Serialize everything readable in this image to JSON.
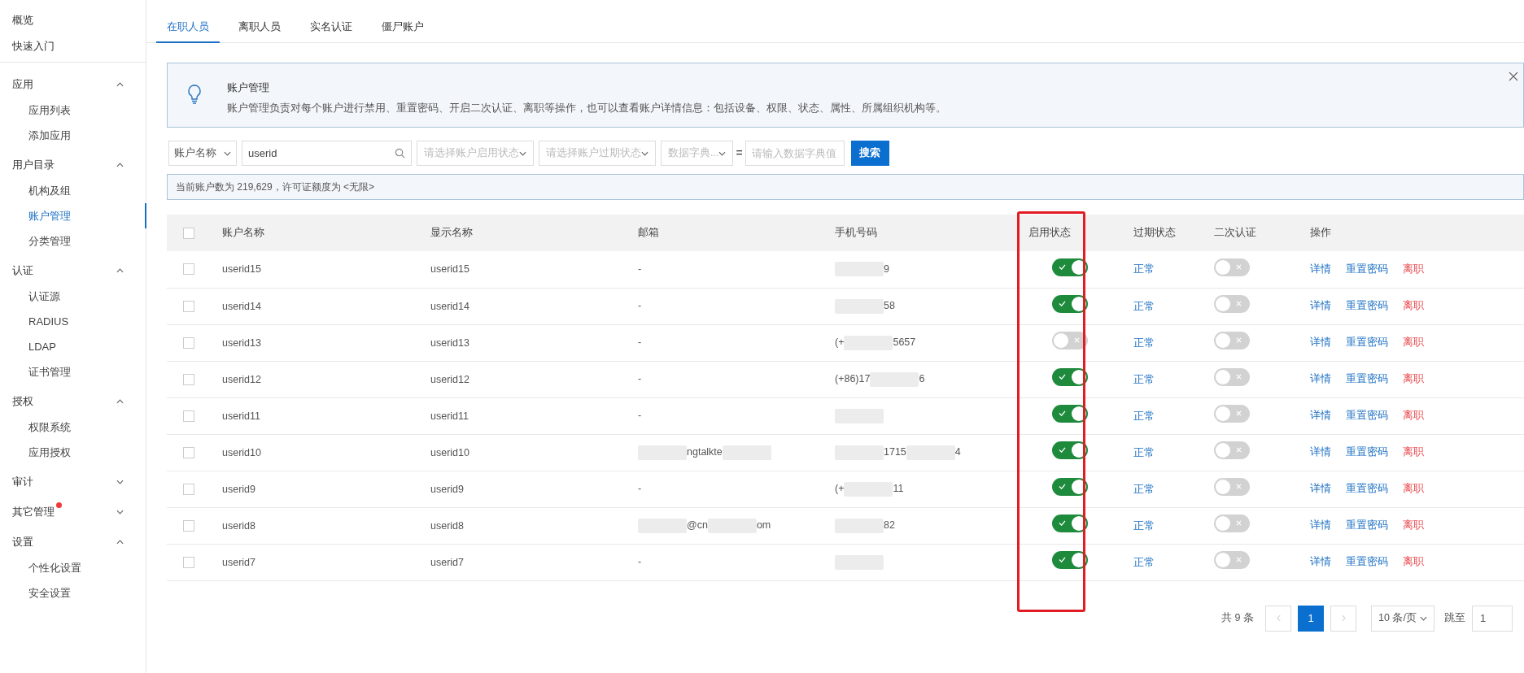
{
  "sidebar": {
    "top_items": [
      {
        "label": "概览",
        "selected": false
      },
      {
        "label": "快速入门",
        "selected": false
      }
    ],
    "groups": [
      {
        "label": "应用",
        "expanded": true,
        "notification": false,
        "items": [
          {
            "label": "应用列表",
            "selected": false
          },
          {
            "label": "添加应用",
            "selected": false
          }
        ]
      },
      {
        "label": "用户目录",
        "expanded": true,
        "notification": false,
        "items": [
          {
            "label": "机构及组",
            "selected": false
          },
          {
            "label": "账户管理",
            "selected": true
          },
          {
            "label": "分类管理",
            "selected": false
          }
        ]
      },
      {
        "label": "认证",
        "expanded": true,
        "notification": false,
        "items": [
          {
            "label": "认证源",
            "selected": false
          },
          {
            "label": "RADIUS",
            "selected": false
          },
          {
            "label": "LDAP",
            "selected": false
          },
          {
            "label": "证书管理",
            "selected": false
          }
        ]
      },
      {
        "label": "授权",
        "expanded": true,
        "notification": false,
        "items": [
          {
            "label": "权限系统",
            "selected": false
          },
          {
            "label": "应用授权",
            "selected": false
          }
        ]
      },
      {
        "label": "审计",
        "expanded": false,
        "notification": false
      },
      {
        "label": "其它管理",
        "expanded": false,
        "notification": true
      },
      {
        "label": "设置",
        "expanded": true,
        "notification": false,
        "items": [
          {
            "label": "个性化设置",
            "selected": false
          },
          {
            "label": "安全设置",
            "selected": false
          }
        ]
      }
    ]
  },
  "tabs": [
    {
      "label": "在职人员",
      "selected": true
    },
    {
      "label": "离职人员",
      "selected": false
    },
    {
      "label": "实名认证",
      "selected": false
    },
    {
      "label": "僵尸账户",
      "selected": false
    }
  ],
  "alert": {
    "title": "账户管理",
    "text": "账户管理负责对每个账户进行禁用、重置密码、开启二次认证、离职等操作，也可以查看账户详情信息：包括设备、权限、状态、属性、所属组织机构等。"
  },
  "filters": {
    "field_select": "账户名称",
    "search_value": "userid",
    "enable_status_placeholder": "请选择账户启用状态",
    "expire_status_placeholder": "请选择账户过期状态",
    "dict_select_placeholder": "数据字典...",
    "equals": "=",
    "dict_value_placeholder": "请输入数据字典值",
    "search_button": "搜索"
  },
  "info": "当前账户数为 219,629，许可证额度为 <无限>",
  "table": {
    "select_all_checked": false,
    "columns": [
      "账户名称",
      "显示名称",
      "邮箱",
      "手机号码",
      "启用状态",
      "过期状态",
      "二次认证",
      "操作"
    ],
    "rows": [
      {
        "checked": false,
        "account": "userid15",
        "display": "userid15",
        "email": [
          {
            "kind": "text",
            "text": "-"
          }
        ],
        "phone": [
          {
            "kind": "mask"
          },
          {
            "kind": "text",
            "text": "9"
          }
        ],
        "enabled": true,
        "expire": "正常",
        "two_factor": false,
        "actions": [
          "详情",
          "重置密码",
          "离职"
        ]
      },
      {
        "checked": false,
        "account": "userid14",
        "display": "userid14",
        "email": [
          {
            "kind": "text",
            "text": "-"
          }
        ],
        "phone": [
          {
            "kind": "mask"
          },
          {
            "kind": "text",
            "text": "58"
          }
        ],
        "enabled": true,
        "expire": "正常",
        "two_factor": false,
        "actions": [
          "详情",
          "重置密码",
          "离职"
        ]
      },
      {
        "checked": false,
        "account": "userid13",
        "display": "userid13",
        "email": [
          {
            "kind": "text",
            "text": "-"
          }
        ],
        "phone": [
          {
            "kind": "text",
            "text": "(+"
          },
          {
            "kind": "mask"
          },
          {
            "kind": "text",
            "text": "5657"
          }
        ],
        "enabled": false,
        "expire": "正常",
        "two_factor": false,
        "actions": [
          "详情",
          "重置密码",
          "离职"
        ]
      },
      {
        "checked": false,
        "account": "userid12",
        "display": "userid12",
        "email": [
          {
            "kind": "text",
            "text": "-"
          }
        ],
        "phone": [
          {
            "kind": "text",
            "text": "(+86)17"
          },
          {
            "kind": "mask"
          },
          {
            "kind": "text",
            "text": "6"
          }
        ],
        "enabled": true,
        "expire": "正常",
        "two_factor": false,
        "actions": [
          "详情",
          "重置密码",
          "离职"
        ]
      },
      {
        "checked": false,
        "account": "userid11",
        "display": "userid11",
        "email": [
          {
            "kind": "text",
            "text": "-"
          }
        ],
        "phone": [
          {
            "kind": "mask"
          }
        ],
        "enabled": true,
        "expire": "正常",
        "two_factor": false,
        "actions": [
          "详情",
          "重置密码",
          "离职"
        ]
      },
      {
        "checked": false,
        "account": "userid10",
        "display": "userid10",
        "email": [
          {
            "kind": "mask"
          },
          {
            "kind": "text",
            "text": "ngtalkte"
          },
          {
            "kind": "mask"
          }
        ],
        "phone": [
          {
            "kind": "mask"
          },
          {
            "kind": "text",
            "text": "1715"
          },
          {
            "kind": "mask"
          },
          {
            "kind": "text",
            "text": "4"
          }
        ],
        "enabled": true,
        "expire": "正常",
        "two_factor": false,
        "actions": [
          "详情",
          "重置密码",
          "离职"
        ]
      },
      {
        "checked": false,
        "account": "userid9",
        "display": "userid9",
        "email": [
          {
            "kind": "text",
            "text": "-"
          }
        ],
        "phone": [
          {
            "kind": "text",
            "text": "(+"
          },
          {
            "kind": "mask"
          },
          {
            "kind": "text",
            "text": "11"
          }
        ],
        "enabled": true,
        "expire": "正常",
        "two_factor": false,
        "actions": [
          "详情",
          "重置密码",
          "离职"
        ]
      },
      {
        "checked": false,
        "account": "userid8",
        "display": "userid8",
        "email": [
          {
            "kind": "mask"
          },
          {
            "kind": "text",
            "text": "@cn"
          },
          {
            "kind": "mask"
          },
          {
            "kind": "text",
            "text": "om"
          }
        ],
        "phone": [
          {
            "kind": "mask"
          },
          {
            "kind": "text",
            "text": "82"
          }
        ],
        "enabled": true,
        "expire": "正常",
        "two_factor": false,
        "actions": [
          "详情",
          "重置密码",
          "离职"
        ]
      },
      {
        "checked": false,
        "account": "userid7",
        "display": "userid7",
        "email": [
          {
            "kind": "text",
            "text": "-"
          }
        ],
        "phone": [
          {
            "kind": "mask"
          }
        ],
        "enabled": true,
        "expire": "正常",
        "two_factor": false,
        "actions": [
          "详情",
          "重置密码",
          "离职"
        ]
      }
    ]
  },
  "pagination": {
    "total": "共 9 条",
    "pages": [
      {
        "label": "1",
        "selected": true
      }
    ],
    "page_size": "10 条/页",
    "jump_label": "跳至",
    "jump_value": "1"
  }
}
